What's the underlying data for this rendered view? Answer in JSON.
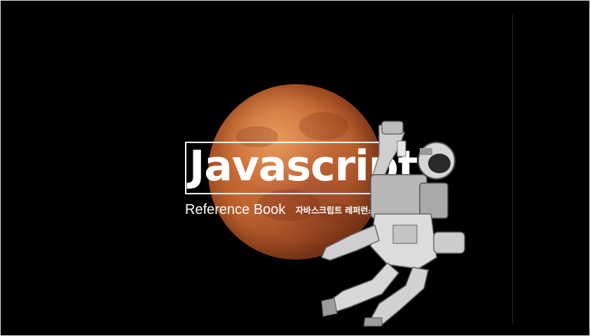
{
  "hero": {
    "title": "Javascript",
    "subtitle_en": "Reference Book",
    "subtitle_ko": "자바스크립트 레퍼런스 북"
  },
  "colors": {
    "background": "#000000",
    "planet": "#c0642f",
    "text": "#ffffff",
    "astronaut_suit": "#d9d9d9"
  },
  "images": {
    "planet": "mars-planet",
    "figure": "astronaut"
  }
}
